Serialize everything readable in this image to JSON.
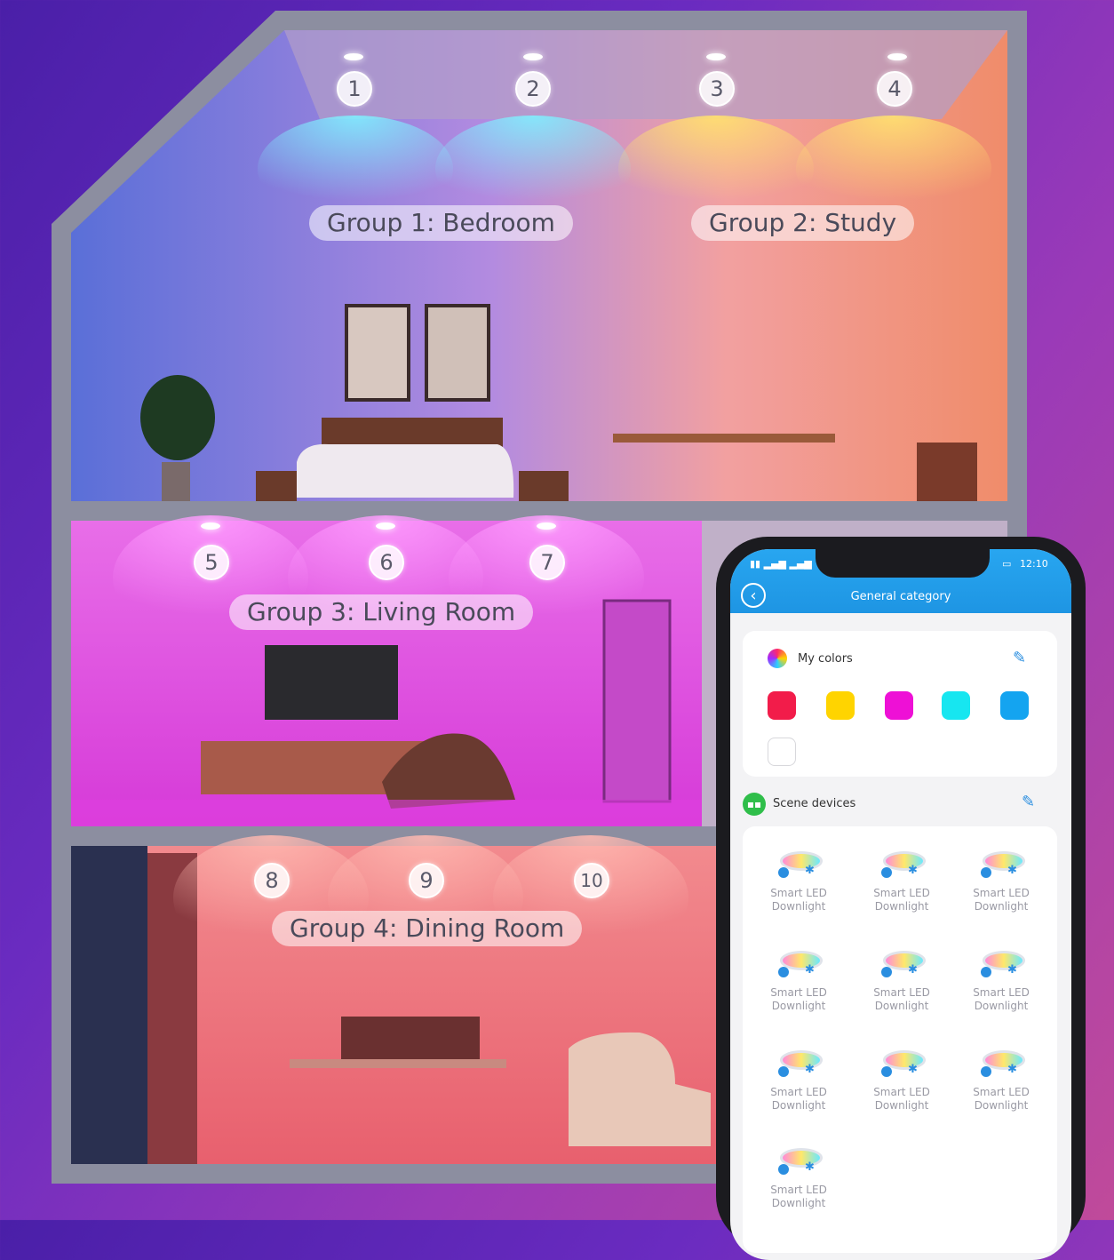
{
  "groups": [
    {
      "label": "Group 1: Bedroom"
    },
    {
      "label": "Group 2: Study"
    },
    {
      "label": "Group 3: Living Room"
    },
    {
      "label": "Group 4: Dining Room"
    }
  ],
  "lights": [
    "1",
    "2",
    "3",
    "4",
    "5",
    "6",
    "7",
    "8",
    "9",
    "10"
  ],
  "phone": {
    "time": "12:10",
    "title": "General category",
    "my_colors_label": "My colors",
    "colors": [
      "#f21c4a",
      "#ffd400",
      "#ee10d6",
      "#17e6f0",
      "#14a4f0",
      "#ffffff"
    ],
    "scene_devices_label": "Scene devices",
    "devices": [
      {
        "line1": "Smart LED",
        "line2": "Downlight"
      },
      {
        "line1": "Smart LED",
        "line2": "Downlight"
      },
      {
        "line1": "Smart LED",
        "line2": "Downlight"
      },
      {
        "line1": "Smart LED",
        "line2": "Downlight"
      },
      {
        "line1": "Smart LED",
        "line2": "Downlight"
      },
      {
        "line1": "Smart LED",
        "line2": "Downlight"
      },
      {
        "line1": "Smart LED",
        "line2": "Downlight"
      },
      {
        "line1": "Smart LED",
        "line2": "Downlight"
      },
      {
        "line1": "Smart LED",
        "line2": "Downlight"
      },
      {
        "line1": "Smart LED",
        "line2": "Downlight"
      }
    ]
  }
}
